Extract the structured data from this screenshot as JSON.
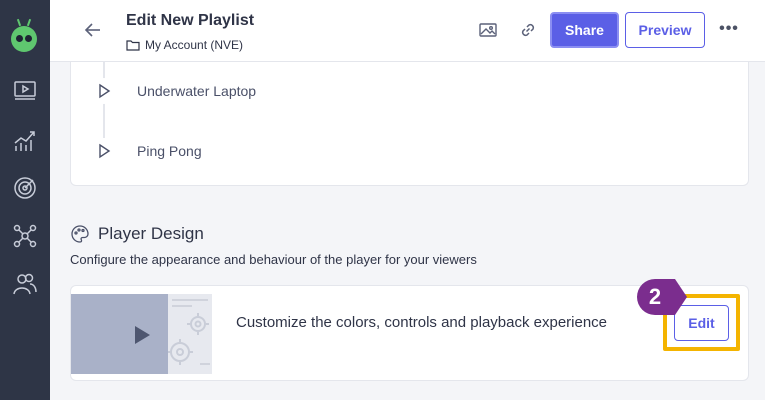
{
  "header": {
    "title": "Edit New Playlist",
    "breadcrumb": "My Account (NVE)",
    "share_label": "Share",
    "preview_label": "Preview",
    "more_label": "•••"
  },
  "sidebar": {
    "items": [
      {
        "name": "video-library-icon"
      },
      {
        "name": "analytics-icon"
      },
      {
        "name": "engagement-icon"
      },
      {
        "name": "integrations-icon"
      },
      {
        "name": "team-icon"
      }
    ]
  },
  "playlist": {
    "items": [
      {
        "label": "Underwater Laptop"
      },
      {
        "label": "Ping Pong"
      }
    ]
  },
  "player_design": {
    "title": "Player Design",
    "subtitle": "Configure the appearance and behaviour of the player for your viewers",
    "card_text": "Customize the colors, controls and playback experience",
    "edit_label": "Edit"
  },
  "tutorial": {
    "step_number": "2"
  },
  "colors": {
    "sidebar_bg": "#2e3546",
    "accent": "#5b5fe6",
    "highlight": "#f4b400",
    "step_badge": "#7b2d8e",
    "logo_green": "#5fc76f"
  }
}
